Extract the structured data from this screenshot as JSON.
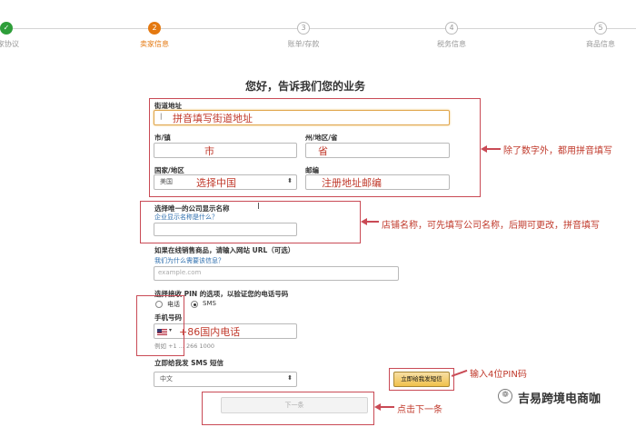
{
  "progress": {
    "steps": [
      {
        "number": "✓",
        "label": "家协议"
      },
      {
        "number": "2",
        "label": "卖家信息"
      },
      {
        "number": "3",
        "label": "账单/存款"
      },
      {
        "number": "4",
        "label": "税务信息"
      },
      {
        "number": "5",
        "label": "商品信息"
      }
    ]
  },
  "heading": "您好，告诉我们您的业务",
  "address": {
    "street_label": "街道地址",
    "street_value": "|",
    "city_label": "市/镇",
    "state_label": "州/地区/省",
    "country_label": "国家/地区",
    "country_value": "美国",
    "zip_label": "邮编"
  },
  "store": {
    "label": "选择唯一的公司显示名称",
    "link": "企业显示名称是什么？"
  },
  "url": {
    "label": "如果在线销售商品，请输入网站 URL（可选）",
    "link": "我们为什么需要该信息？",
    "placeholder": "example.com"
  },
  "pin": {
    "label": "选择接收 PIN 的选项，以验证您的电话号码",
    "option_phone": "电话",
    "option_sms": "SMS",
    "phone_label": "手机号码",
    "example": "例如 +1 ... 266 1000",
    "sms_label": "立即给我发 SMS 短信",
    "language_value": "中文",
    "send_button": "立即给我发短信",
    "next_button": "下一条"
  },
  "overlays": {
    "street": "拼音填写街道地址",
    "city": "市",
    "state": "省",
    "country": "选择中国",
    "zip": "注册地址邮编",
    "phone": "+86国内电话"
  },
  "annotations": {
    "address_note": "除了数字外，都用拼音填写",
    "store_note": "店铺名称，可先填写公司名称，后期可更改，拼音填写",
    "pin_note": "输入4位PIN码",
    "next_note": "点击下一条"
  },
  "watermark": {
    "icon": "wechat-icon",
    "text": "吉易跨境电商咖"
  },
  "colors": {
    "accent": "#e47911",
    "done": "#2e9e3a",
    "annotation_red": "#c0392b",
    "link_blue": "#2b6dad"
  }
}
